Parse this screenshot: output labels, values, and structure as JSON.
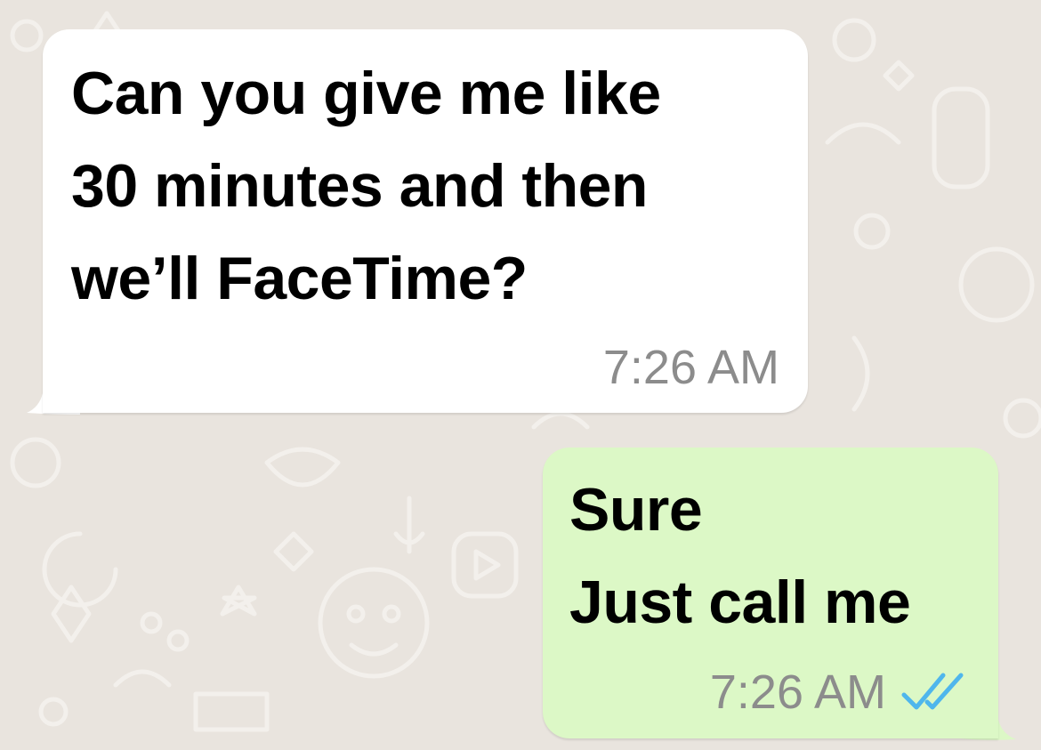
{
  "chat": {
    "messages": [
      {
        "direction": "incoming",
        "lines": [
          "Can you give me like",
          "30 minutes and then",
          "we’ll FaceTime?"
        ],
        "time": "7:26 AM"
      },
      {
        "direction": "outgoing",
        "lines": [
          "Sure",
          "Just call me"
        ],
        "time": "7:26 AM",
        "status_icon": "double-check-icon",
        "status": "read"
      }
    ]
  },
  "colors": {
    "background": "#e9e4de",
    "incoming_bubble": "#ffffff",
    "outgoing_bubble": "#dcf8c6",
    "timestamp": "#8c8c8c",
    "read_receipt": "#4fb6ec"
  }
}
